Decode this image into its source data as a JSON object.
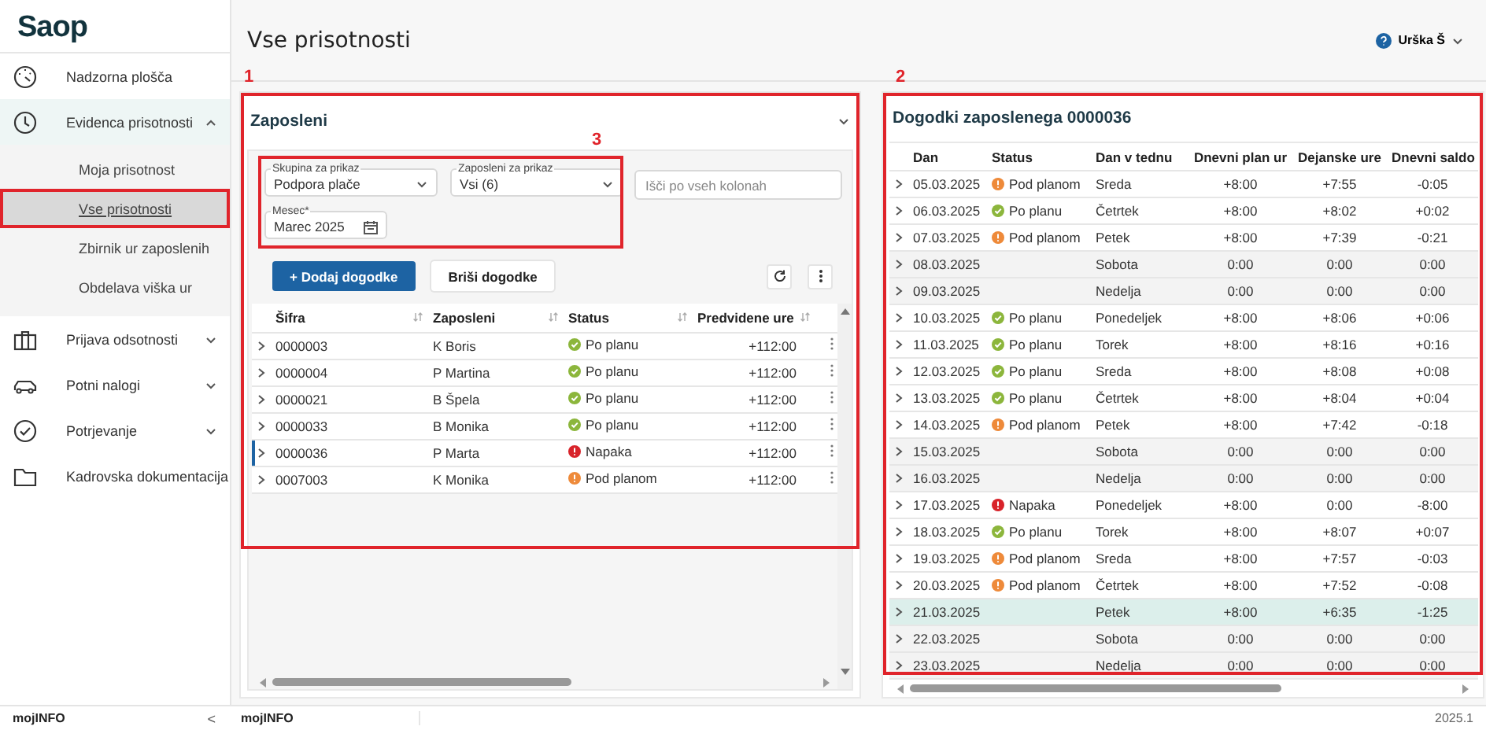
{
  "sidebar": {
    "logo": "Saop",
    "items": [
      {
        "label": "Nadzorna plošča"
      },
      {
        "label": "Evidenca prisotnosti",
        "expanded": true,
        "children": [
          {
            "label": "Moja prisotnost",
            "selected": false,
            "outlined": false
          },
          {
            "label": "Vse prisotnosti",
            "selected": true,
            "outlined": true
          },
          {
            "label": "Zbirnik ur zaposlenih",
            "selected": false,
            "outlined": false
          },
          {
            "label": "Obdelava viška ur",
            "selected": false,
            "outlined": false
          }
        ]
      },
      {
        "label": "Prijava odsotnosti",
        "expanded": false
      },
      {
        "label": "Potni nalogi",
        "expanded": false
      },
      {
        "label": "Potrjevanje",
        "expanded": false
      },
      {
        "label": "Kadrovska dokumentacija"
      }
    ],
    "footer": "mojINFO",
    "collapse": "<"
  },
  "header": {
    "title": "Vse prisotnosti",
    "user": "Urška Š"
  },
  "left_panel": {
    "title": "Zaposleni",
    "callout": "1",
    "filters": {
      "callout": "3",
      "fields": [
        {
          "label": "Skupina za prikaz",
          "value": "Podpora plače",
          "kind": "select"
        },
        {
          "label": "Zaposleni za prikaz",
          "value": "Vsi (6)",
          "kind": "select"
        },
        {
          "label": "Mesec*",
          "value": "Marec 2025",
          "kind": "date"
        }
      ]
    },
    "search": {
      "placeholder": "Išči po vseh kolonah"
    },
    "buttons": [
      {
        "label": "+ Dodaj dogodke",
        "kind": "primary"
      },
      {
        "label": "Briši dogodke",
        "kind": "secondary"
      }
    ],
    "table": {
      "columns": [
        "Šifra",
        "Zaposleni",
        "Status",
        "Predvidene ure"
      ],
      "rows": [
        {
          "code": "0000003",
          "name": "K Boris",
          "status": {
            "text": "Po planu",
            "kind": "ok"
          },
          "hours": "+112:00",
          "selected": false
        },
        {
          "code": "0000004",
          "name": "P Martina",
          "status": {
            "text": "Po planu",
            "kind": "ok"
          },
          "hours": "+112:00",
          "selected": false
        },
        {
          "code": "0000021",
          "name": "B Špela",
          "status": {
            "text": "Po planu",
            "kind": "ok"
          },
          "hours": "+112:00",
          "selected": false
        },
        {
          "code": "0000033",
          "name": "B Monika",
          "status": {
            "text": "Po planu",
            "kind": "ok"
          },
          "hours": "+112:00",
          "selected": false
        },
        {
          "code": "0000036",
          "name": "P Marta",
          "status": {
            "text": "Napaka",
            "kind": "error"
          },
          "hours": "+112:00",
          "selected": true
        },
        {
          "code": "0007003",
          "name": "K Monika",
          "status": {
            "text": "Pod planom",
            "kind": "warn"
          },
          "hours": "+112:00",
          "selected": false
        }
      ]
    }
  },
  "right_panel": {
    "title": "Dogodki zaposlenega 0000036",
    "callout": "2",
    "table": {
      "columns": [
        "Dan",
        "Status",
        "Dan v tednu",
        "Dnevni plan ur",
        "Dejanske ure",
        "Dnevni saldo"
      ],
      "rows": [
        {
          "date": "05.03.2025",
          "status": {
            "text": "Pod planom",
            "kind": "warn"
          },
          "day": "Sreda",
          "plan": "+8:00",
          "actual": "+7:55",
          "saldo": "-0:05",
          "weekend": false,
          "selected": false
        },
        {
          "date": "06.03.2025",
          "status": {
            "text": "Po planu",
            "kind": "ok"
          },
          "day": "Četrtek",
          "plan": "+8:00",
          "actual": "+8:02",
          "saldo": "+0:02",
          "weekend": false,
          "selected": false
        },
        {
          "date": "07.03.2025",
          "status": {
            "text": "Pod planom",
            "kind": "warn"
          },
          "day": "Petek",
          "plan": "+8:00",
          "actual": "+7:39",
          "saldo": "-0:21",
          "weekend": false,
          "selected": false
        },
        {
          "date": "08.03.2025",
          "day": "Sobota",
          "plan": "0:00",
          "actual": "0:00",
          "saldo": "0:00",
          "weekend": true,
          "selected": false
        },
        {
          "date": "09.03.2025",
          "day": "Nedelja",
          "plan": "0:00",
          "actual": "0:00",
          "saldo": "0:00",
          "weekend": true,
          "selected": false
        },
        {
          "date": "10.03.2025",
          "status": {
            "text": "Po planu",
            "kind": "ok"
          },
          "day": "Ponedeljek",
          "plan": "+8:00",
          "actual": "+8:06",
          "saldo": "+0:06",
          "weekend": false,
          "selected": false
        },
        {
          "date": "11.03.2025",
          "status": {
            "text": "Po planu",
            "kind": "ok"
          },
          "day": "Torek",
          "plan": "+8:00",
          "actual": "+8:16",
          "saldo": "+0:16",
          "weekend": false,
          "selected": false
        },
        {
          "date": "12.03.2025",
          "status": {
            "text": "Po planu",
            "kind": "ok"
          },
          "day": "Sreda",
          "plan": "+8:00",
          "actual": "+8:08",
          "saldo": "+0:08",
          "weekend": false,
          "selected": false
        },
        {
          "date": "13.03.2025",
          "status": {
            "text": "Po planu",
            "kind": "ok"
          },
          "day": "Četrtek",
          "plan": "+8:00",
          "actual": "+8:04",
          "saldo": "+0:04",
          "weekend": false,
          "selected": false
        },
        {
          "date": "14.03.2025",
          "status": {
            "text": "Pod planom",
            "kind": "warn"
          },
          "day": "Petek",
          "plan": "+8:00",
          "actual": "+7:42",
          "saldo": "-0:18",
          "weekend": false,
          "selected": false
        },
        {
          "date": "15.03.2025",
          "day": "Sobota",
          "plan": "0:00",
          "actual": "0:00",
          "saldo": "0:00",
          "weekend": true,
          "selected": false
        },
        {
          "date": "16.03.2025",
          "day": "Nedelja",
          "plan": "0:00",
          "actual": "0:00",
          "saldo": "0:00",
          "weekend": true,
          "selected": false
        },
        {
          "date": "17.03.2025",
          "status": {
            "text": "Napaka",
            "kind": "error"
          },
          "day": "Ponedeljek",
          "plan": "+8:00",
          "actual": "0:00",
          "saldo": "-8:00",
          "weekend": false,
          "selected": false
        },
        {
          "date": "18.03.2025",
          "status": {
            "text": "Po planu",
            "kind": "ok"
          },
          "day": "Torek",
          "plan": "+8:00",
          "actual": "+8:07",
          "saldo": "+0:07",
          "weekend": false,
          "selected": false
        },
        {
          "date": "19.03.2025",
          "status": {
            "text": "Pod planom",
            "kind": "warn"
          },
          "day": "Sreda",
          "plan": "+8:00",
          "actual": "+7:57",
          "saldo": "-0:03",
          "weekend": false,
          "selected": false
        },
        {
          "date": "20.03.2025",
          "status": {
            "text": "Pod planom",
            "kind": "warn"
          },
          "day": "Četrtek",
          "plan": "+8:00",
          "actual": "+7:52",
          "saldo": "-0:08",
          "weekend": false,
          "selected": false
        },
        {
          "date": "21.03.2025",
          "day": "Petek",
          "plan": "+8:00",
          "actual": "+6:35",
          "saldo": "-1:25",
          "weekend": false,
          "selected": true
        },
        {
          "date": "22.03.2025",
          "day": "Sobota",
          "plan": "0:00",
          "actual": "0:00",
          "saldo": "0:00",
          "weekend": true,
          "selected": false
        },
        {
          "date": "23.03.2025",
          "day": "Nedelja",
          "plan": "0:00",
          "actual": "0:00",
          "saldo": "0:00",
          "weekend": true,
          "selected": false
        }
      ]
    }
  },
  "footer": {
    "label": "mojINFO",
    "version": "2025.1"
  }
}
